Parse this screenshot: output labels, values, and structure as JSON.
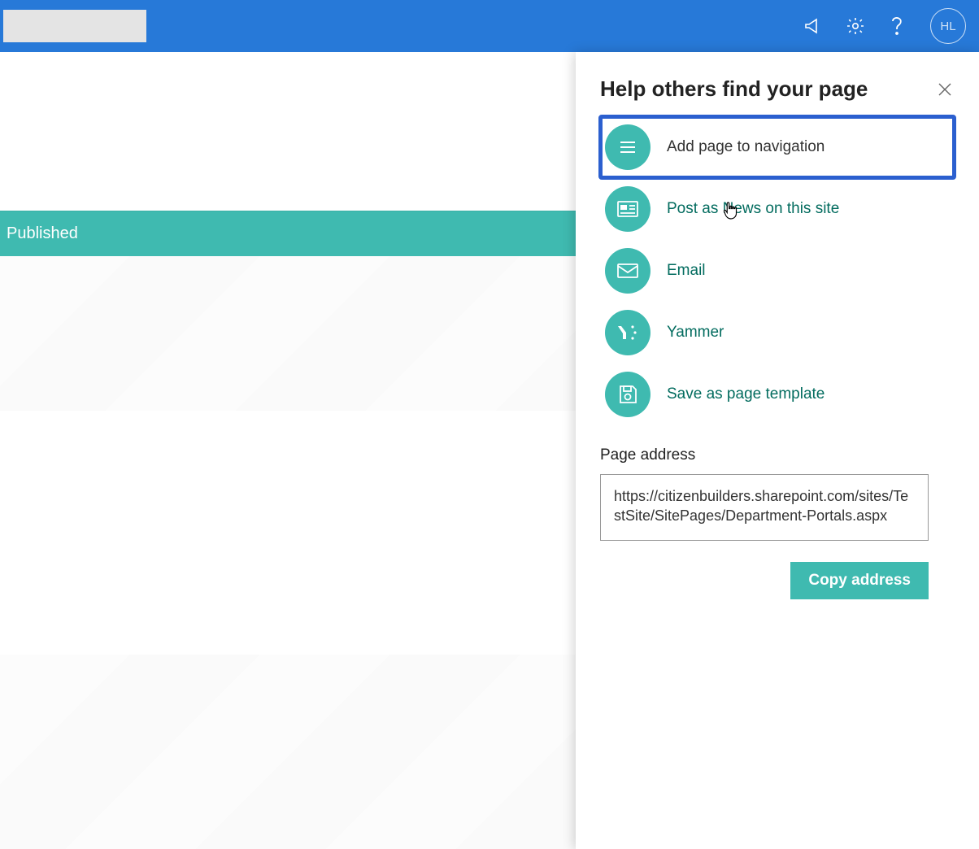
{
  "header": {
    "avatar_initials": "HL"
  },
  "page": {
    "status_banner": "Published"
  },
  "panel": {
    "title": "Help others find your page",
    "options": [
      {
        "label": "Add page to navigation",
        "icon": "hamburger-icon",
        "highlighted": true
      },
      {
        "label": "Post as News on this site",
        "icon": "news-icon",
        "highlighted": false
      },
      {
        "label": "Email",
        "icon": "mail-icon",
        "highlighted": false
      },
      {
        "label": "Yammer",
        "icon": "yammer-icon",
        "highlighted": false
      },
      {
        "label": "Save as page template",
        "icon": "save-icon",
        "highlighted": false
      }
    ],
    "page_address_label": "Page address",
    "page_address_value": "https://citizenbuilders.sharepoint.com/sites/TestSite/SitePages/Department-Portals.aspx",
    "copy_button_label": "Copy address"
  },
  "colors": {
    "brand_blue": "#2779d8",
    "teal": "#3fbab0",
    "highlight_outline": "#2b5fcf"
  }
}
